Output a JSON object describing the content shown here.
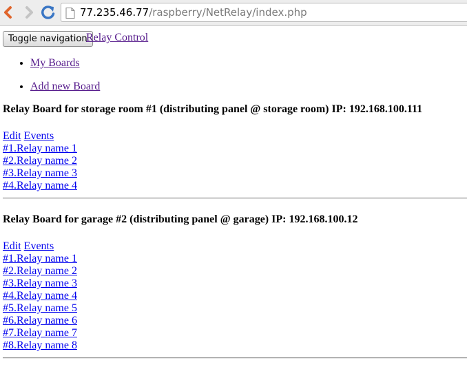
{
  "browser": {
    "url_host": "77.235.46.77",
    "url_path": "/raspberry/NetRelay/index.php",
    "icons": [
      "back-arrow-icon",
      "forward-arrow-icon",
      "reload-icon",
      "page-icon"
    ]
  },
  "navbar": {
    "toggle_label": "Toggle navigation",
    "brand": "Relay Control"
  },
  "menu": [
    {
      "label": "My Boards"
    },
    {
      "label": "Add new Board"
    }
  ],
  "boards": [
    {
      "title": "Relay Board for storage room #1 (distributing panel @ storage room) IP: 192.168.100.111",
      "edit": "Edit",
      "events": "Events",
      "relays": [
        "#1.Relay name 1",
        "#2.Relay name 2",
        "#3.Relay name 3",
        "#4.Relay name 4"
      ]
    },
    {
      "title": "Relay Board for garage #2 (distributing panel @ garage) IP: 192.168.100.12",
      "edit": "Edit",
      "events": "Events",
      "relays": [
        "#1.Relay name 1",
        "#2.Relay name 2",
        "#3.Relay name 3",
        "#4.Relay name 4",
        "#5.Relay name 5",
        "#6.Relay name 6",
        "#7.Relay name 7",
        "#8.Relay name 8"
      ]
    }
  ],
  "colors": {
    "visited_link": "#551a8b",
    "link": "#0000ee",
    "back_arrow": "#e0652c",
    "reload": "#3a76c4"
  }
}
